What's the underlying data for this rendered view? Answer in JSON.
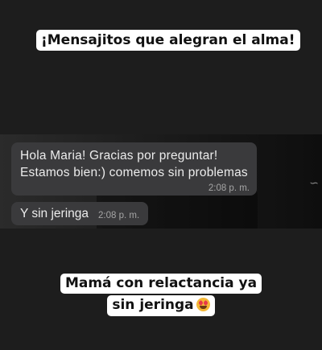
{
  "story": {
    "top_caption": "¡Mensajitos que alegran el alma!",
    "bottom_caption_line1": "Mamá con relactancia ya",
    "bottom_caption_line2": "sin jeringa",
    "bottom_caption_emoji": "smiling-face-with-heart-eyes-emoji"
  },
  "chat": {
    "messages": [
      {
        "line1": "Hola Maria! Gracias por preguntar!",
        "line2": "Estamos bien:) comemos sin problemas",
        "time": "2:08 p. m."
      },
      {
        "text": "Y sin jeringa",
        "time": "2:08 p. m."
      }
    ]
  }
}
